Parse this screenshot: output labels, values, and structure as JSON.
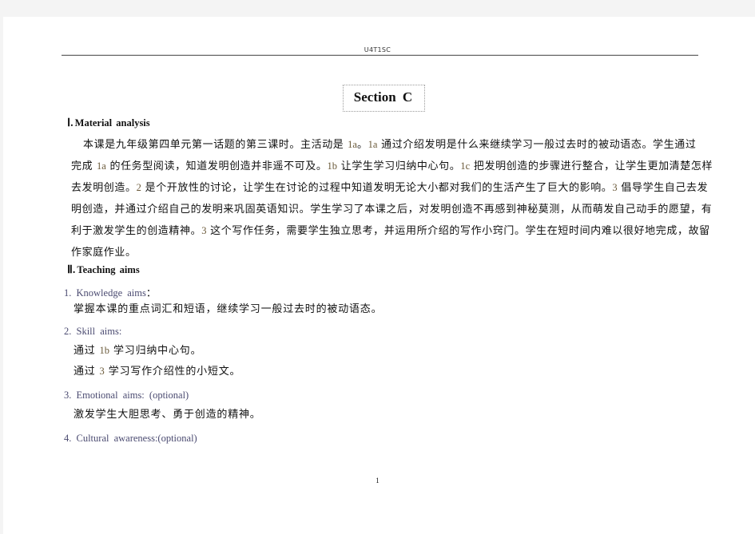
{
  "header": {
    "label": "U4T1SC"
  },
  "section_title": "Section  C",
  "section1": {
    "numeral": "Ⅰ.",
    "title": "Material  analysis",
    "lines": [
      [
        "本课是九年级第四单元第一话题的第三课时。主活动是 ",
        "1a",
        "。",
        "1a",
        " 通过介绍发明是什么来继续学习一般过去时的被动语态。学生通过"
      ],
      [
        "完成 ",
        "1a",
        " 的任务型阅读，知道发明创造并非遥不可及。",
        "1b",
        " 让学生学习归纳中心句。",
        "1c",
        " 把发明创造的步骤进行整合，让学生更加清楚怎样"
      ],
      [
        "去发明创造。",
        "2",
        " 是个开放性的讨论，让学生在讨论的过程中知道发明无论大小都对我们的生活产生了巨大的影响。",
        "3",
        " 倡导学生自己去发"
      ],
      [
        "明创造，并通过介绍自己的发明来巩固英语知识。学生学习了本课之后，对发明创造不再感到神秘莫测，从而萌发自己动手的愿望，有"
      ],
      [
        "利于激发学生的创造精神。",
        "3",
        " 这个写作任务，需要学生独立思考，并运用所介绍的写作小窍门。学生在短时间内难以很好地完成，故留"
      ],
      [
        "作家庭作业。"
      ]
    ]
  },
  "section2": {
    "numeral": "Ⅱ.",
    "title": "Teaching  aims",
    "aims": [
      {
        "label": "1.  Knowledge  aims",
        "suffix": "：",
        "items": [
          [
            "掌握本课的重点词汇和短语，继续学习一般过去时的被动语态。"
          ]
        ]
      },
      {
        "label": "2.  Skill  aims:",
        "suffix": "",
        "items": [
          [
            "通过 ",
            "1b",
            " 学习归纳中心句。"
          ],
          [
            "通过 ",
            "3",
            " 学习写作介绍性的小短文。"
          ]
        ]
      },
      {
        "label": "3.  Emotional  aims:  (optional)",
        "suffix": "",
        "items": [
          [
            "激发学生大胆思考、勇于创造的精神。"
          ]
        ]
      },
      {
        "label": "4.  Cultural  awareness:(optional)",
        "suffix": "",
        "items": []
      }
    ]
  },
  "footer": {
    "page_number": "1"
  }
}
